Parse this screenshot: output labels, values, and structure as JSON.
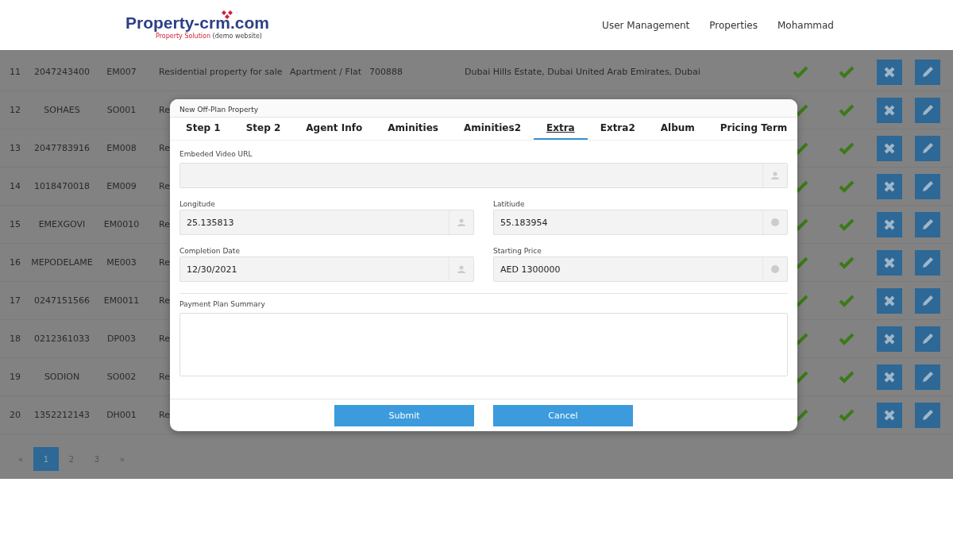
{
  "header": {
    "logo": {
      "name": "Property-crm.com",
      "tagline_red": "Property Solution",
      "tagline": "(demo website)"
    },
    "nav": [
      "User Management",
      "Properties",
      "Mohammad"
    ]
  },
  "table": {
    "rows": [
      {
        "cells": [
          "11",
          "2047243400",
          "EM007",
          "Residential property for sale",
          "Apartment / Flat",
          "700888",
          "Dubai Hills Estate, Dubai United Arab Emirates, Dubai"
        ]
      },
      {
        "cells": [
          "12",
          "SOHAES",
          "SO001",
          "Re"
        ]
      },
      {
        "cells": [
          "13",
          "2047783916",
          "EM008",
          "Re"
        ]
      },
      {
        "cells": [
          "14",
          "1018470018",
          "EM009",
          "Re"
        ]
      },
      {
        "cells": [
          "15",
          "EMEXGOVI",
          "EM0010",
          "Re"
        ]
      },
      {
        "cells": [
          "16",
          "MEPODELAME",
          "ME003",
          "Re"
        ]
      },
      {
        "cells": [
          "17",
          "0247151566",
          "EM0011",
          "Re"
        ]
      },
      {
        "cells": [
          "18",
          "0212361033",
          "DP003",
          "Re"
        ]
      },
      {
        "cells": [
          "19",
          "SODION",
          "SO002",
          "Re"
        ]
      },
      {
        "cells": [
          "20",
          "1352212143",
          "DH001",
          "Re"
        ]
      }
    ]
  },
  "pagination": {
    "prev": "«",
    "next": "»",
    "pages": [
      {
        "label": "1",
        "selected": true
      },
      {
        "label": "2",
        "selected": false
      },
      {
        "label": "3",
        "selected": false
      }
    ]
  },
  "modal": {
    "title": "New Off-Plan Property",
    "tabs": [
      {
        "label": "Step 1",
        "selected": false
      },
      {
        "label": "Step 2",
        "selected": false
      },
      {
        "label": "Agent Info",
        "selected": false
      },
      {
        "label": "Aminities",
        "selected": false
      },
      {
        "label": "Aminities2",
        "selected": false
      },
      {
        "label": "Extra",
        "selected": true
      },
      {
        "label": "Extra2",
        "selected": false
      },
      {
        "label": "Album",
        "selected": false
      },
      {
        "label": "Pricing Term",
        "selected": false
      }
    ],
    "video_url": {
      "label": "Embeded Video URL"
    },
    "fields": [
      {
        "label": "Longitude",
        "value": "25.135813",
        "kind": "person"
      },
      {
        "label": "Latitiude",
        "value": "55.183954",
        "kind": "dot"
      },
      {
        "label": "Completion Date",
        "value": "12/30/2021",
        "kind": "person"
      },
      {
        "label": "Starting Price",
        "value": "AED 1300000",
        "kind": "dot"
      }
    ],
    "payment_plan": {
      "label": "Payment Plan Summary"
    },
    "buttons": [
      "Submit",
      "Cancel"
    ]
  }
}
